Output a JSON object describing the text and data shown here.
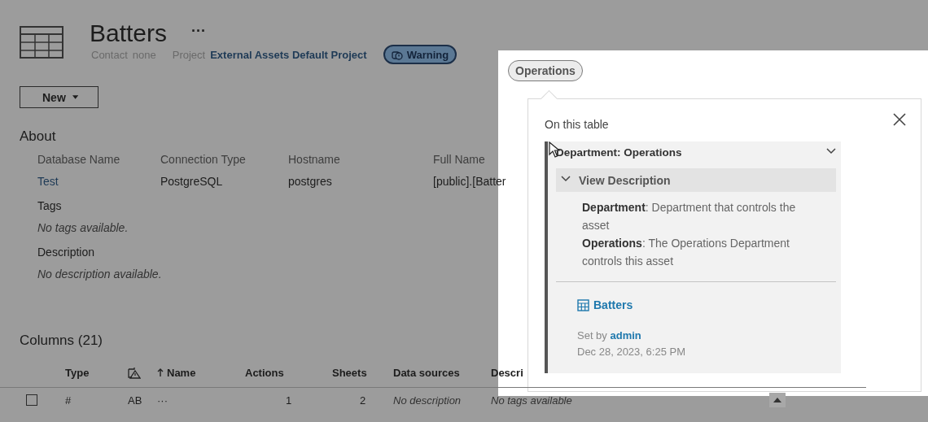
{
  "header": {
    "title": "Batters",
    "more": "···",
    "contact_label": "Contact",
    "contact": "none",
    "project_label": "Project",
    "project": "External Assets Default Project",
    "badges": [
      {
        "label": "Warning",
        "kind": "warning",
        "selected": false
      },
      {
        "label": "Operations",
        "kind": "category",
        "selected": true
      }
    ]
  },
  "new_button": "New",
  "about": {
    "heading": "About",
    "fields": [
      {
        "label": "Database Name",
        "value": "Test",
        "kind": "link"
      },
      {
        "label": "Connection Type",
        "value": "PostgreSQL",
        "kind": "plain"
      },
      {
        "label": "Hostname",
        "value": "postgres",
        "kind": "plain"
      },
      {
        "label": "Full Name",
        "value": "[public].[Batter",
        "kind": "plain"
      }
    ],
    "sections": [
      {
        "label": "Tags",
        "value": "No tags available."
      },
      {
        "label": "Description",
        "value": "No description available."
      }
    ]
  },
  "columns": {
    "heading": "Columns (21)",
    "headers": [
      {
        "kind": "text",
        "label": "Type",
        "sorted": false
      },
      {
        "kind": "icon"
      },
      {
        "kind": "text",
        "label": "Name",
        "sorted": true
      },
      {
        "kind": "text",
        "label": "Actions",
        "sorted": false
      },
      {
        "kind": "text",
        "label": "Sheets",
        "sorted": false
      },
      {
        "kind": "text",
        "label": "Data sources",
        "sorted": false
      },
      {
        "kind": "text",
        "label": "Descri",
        "sorted": false
      }
    ],
    "rows": [
      {
        "checked": false,
        "cells": [
          "#",
          "AB",
          "···",
          "1",
          "2",
          "No description",
          "No tags available"
        ]
      }
    ]
  },
  "popover": {
    "heading": "On this table",
    "item": {
      "title": "Department: Operations",
      "expanded": true,
      "toggle_label": "View Description",
      "description": [
        "**Department**: Department that controls the asset",
        "**Operations**: The Operations Department controls this asset"
      ],
      "asset": "Batters",
      "set_by_label": "Set by",
      "set_by": "admin",
      "date": "Dec 28, 2023, 6:25 PM"
    }
  }
}
